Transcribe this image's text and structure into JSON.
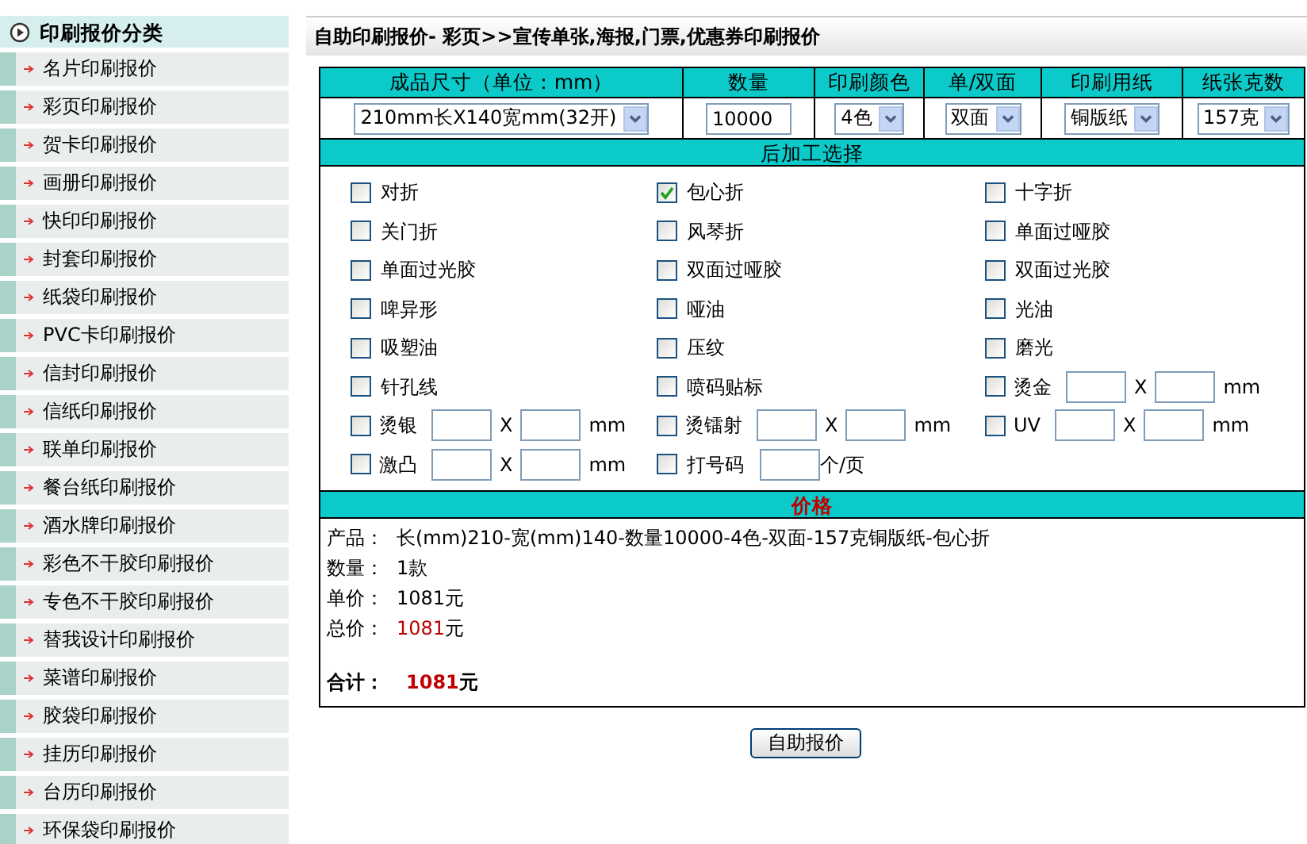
{
  "sidebar": {
    "title": "印刷报价分类",
    "items": [
      {
        "label": "名片印刷报价"
      },
      {
        "label": "彩页印刷报价"
      },
      {
        "label": "贺卡印刷报价"
      },
      {
        "label": "画册印刷报价"
      },
      {
        "label": "快印印刷报价"
      },
      {
        "label": "封套印刷报价"
      },
      {
        "label": "纸袋印刷报价"
      },
      {
        "label": "PVC卡印刷报价"
      },
      {
        "label": "信封印刷报价"
      },
      {
        "label": "信纸印刷报价"
      },
      {
        "label": "联单印刷报价"
      },
      {
        "label": "餐台纸印刷报价"
      },
      {
        "label": "酒水牌印刷报价"
      },
      {
        "label": "彩色不干胶印刷报价"
      },
      {
        "label": "专色不干胶印刷报价"
      },
      {
        "label": "替我设计印刷报价"
      },
      {
        "label": "菜谱印刷报价"
      },
      {
        "label": "胶袋印刷报价"
      },
      {
        "label": "挂历印刷报价"
      },
      {
        "label": "台历印刷报价"
      },
      {
        "label": "环保袋印刷报价"
      }
    ]
  },
  "page_title": "自助印刷报价- 彩页>>宣传单张,海报,门票,优惠券印刷报价",
  "spec_columns": [
    {
      "heading": "成品尺寸（单位：mm）",
      "kind": "select",
      "value": "210mm长X140宽mm(32开)"
    },
    {
      "heading": "数量",
      "kind": "input",
      "value": "10000"
    },
    {
      "heading": "印刷颜色",
      "kind": "select",
      "value": "4色"
    },
    {
      "heading": "单/双面",
      "kind": "select",
      "value": "双面"
    },
    {
      "heading": "印刷用纸",
      "kind": "select",
      "value": "铜版纸"
    },
    {
      "heading": "纸张克数",
      "kind": "select",
      "value": "157克"
    }
  ],
  "finishing": {
    "title": "后加工选择",
    "options": [
      {
        "label": "对折",
        "checked": false,
        "kind": "plain"
      },
      {
        "label": "包心折",
        "checked": true,
        "kind": "plain"
      },
      {
        "label": "十字折",
        "checked": false,
        "kind": "plain"
      },
      {
        "label": "关门折",
        "checked": false,
        "kind": "plain"
      },
      {
        "label": "风琴折",
        "checked": false,
        "kind": "plain"
      },
      {
        "label": "单面过哑胶",
        "checked": false,
        "kind": "plain"
      },
      {
        "label": "单面过光胶",
        "checked": false,
        "kind": "plain"
      },
      {
        "label": "双面过哑胶",
        "checked": false,
        "kind": "plain"
      },
      {
        "label": "双面过光胶",
        "checked": false,
        "kind": "plain"
      },
      {
        "label": "啤异形",
        "checked": false,
        "kind": "plain"
      },
      {
        "label": "哑油",
        "checked": false,
        "kind": "plain"
      },
      {
        "label": "光油",
        "checked": false,
        "kind": "plain"
      },
      {
        "label": "吸塑油",
        "checked": false,
        "kind": "plain"
      },
      {
        "label": "压纹",
        "checked": false,
        "kind": "plain"
      },
      {
        "label": "磨光",
        "checked": false,
        "kind": "plain"
      },
      {
        "label": "针孔线",
        "checked": false,
        "kind": "plain"
      },
      {
        "label": "喷码贴标",
        "checked": false,
        "kind": "plain"
      },
      {
        "label": "烫金",
        "checked": false,
        "kind": "size",
        "separator": "X",
        "unit": "mm"
      },
      {
        "label": "烫银",
        "checked": false,
        "kind": "size",
        "separator": "X",
        "unit": "mm"
      },
      {
        "label": "烫镭射",
        "checked": false,
        "kind": "size",
        "separator": "X",
        "unit": "mm"
      },
      {
        "label": "UV",
        "checked": false,
        "kind": "size",
        "separator": "X",
        "unit": "mm"
      },
      {
        "label": "激凸",
        "checked": false,
        "kind": "size",
        "separator": "X",
        "unit": "mm"
      },
      {
        "label": "打号码",
        "checked": false,
        "kind": "count",
        "unit": "个/页"
      }
    ]
  },
  "price": {
    "title": "价格",
    "lines": [
      {
        "label": "产品：",
        "value": "长(mm)210-宽(mm)140-数量10000-4色-双面-157克铜版纸-包心折",
        "kind": "plain"
      },
      {
        "label": "数量：",
        "value": "1款",
        "kind": "plain"
      },
      {
        "label": "单价：",
        "value": "1081元",
        "kind": "plain"
      },
      {
        "label": "总价：",
        "amount": "1081",
        "unit": "元",
        "kind": "highlight"
      }
    ],
    "total": {
      "label": "合计：",
      "amount": "1081",
      "unit": "元"
    }
  },
  "submit_button": "自助报价"
}
